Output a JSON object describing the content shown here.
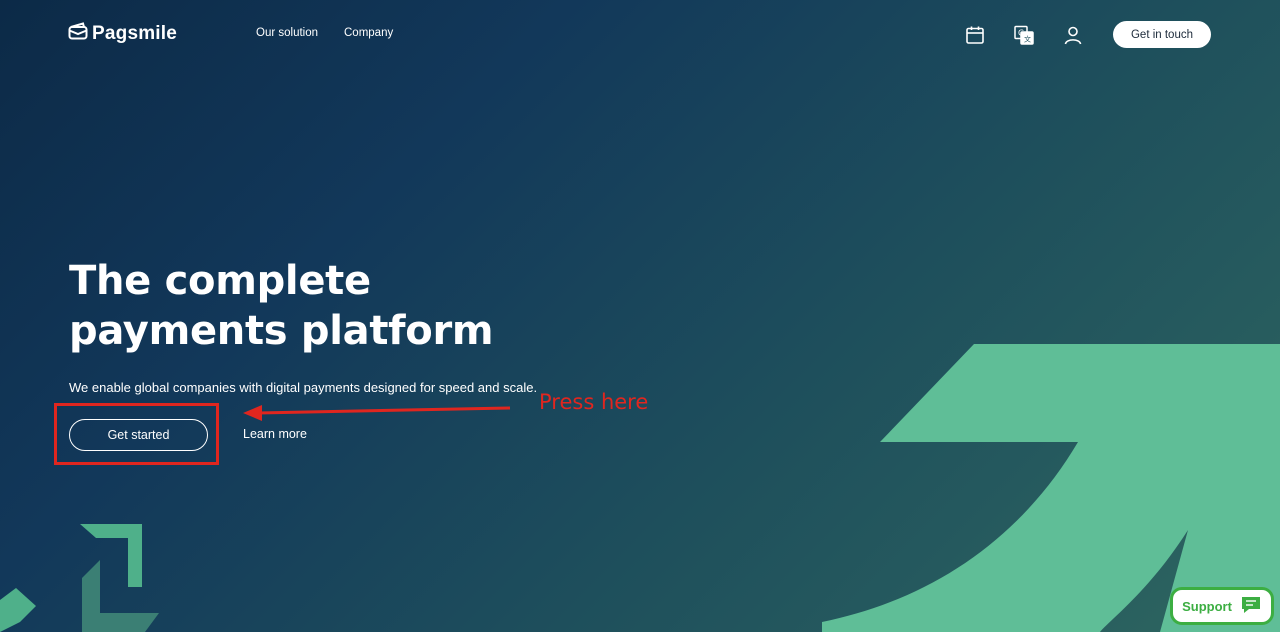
{
  "brand": {
    "name": "Pagsmile",
    "logo_icon": "wallet-icon"
  },
  "nav": {
    "items": [
      "Our solution",
      "Company"
    ]
  },
  "header": {
    "icons": [
      "calendar-icon",
      "translate-icon",
      "user-icon"
    ],
    "cta_label": "Get in touch"
  },
  "hero": {
    "title_line1": "The complete",
    "title_line2": "payments platform",
    "subtitle": "We enable global companies with digital payments designed for speed and scale.",
    "primary_button": "Get started",
    "secondary_link": "Learn more"
  },
  "annotation": {
    "text": "Press here",
    "color": "#e0261f"
  },
  "support": {
    "label": "Support",
    "icon": "chat-icon",
    "color": "#3cae42"
  },
  "colors": {
    "accent_green": "#5fbe97",
    "bg_dark": "#0c2a47"
  }
}
